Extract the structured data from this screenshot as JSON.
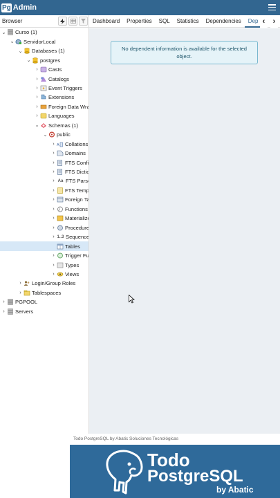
{
  "app": {
    "logo_mark": "Pg",
    "logo_text": "Admin"
  },
  "left_panel": {
    "title": "Browser"
  },
  "toolbar": {
    "icons": [
      "query-tool-icon",
      "view-data-icon",
      "filter-icon"
    ]
  },
  "tabs": [
    {
      "label": "Dashboard",
      "active": false
    },
    {
      "label": "Properties",
      "active": false
    },
    {
      "label": "SQL",
      "active": false
    },
    {
      "label": "Statistics",
      "active": false
    },
    {
      "label": "Dependencies",
      "active": false
    },
    {
      "label": "Dep",
      "active": true
    }
  ],
  "tab_nav": {
    "prev": "‹",
    "next": "›"
  },
  "tree": [
    {
      "label": "Curso (1)",
      "level": 0,
      "toggle": "open",
      "icon": "server-group-icon"
    },
    {
      "label": "ServidorLocal",
      "level": 1,
      "toggle": "open",
      "icon": "server-icon"
    },
    {
      "label": "Databases (1)",
      "level": 2,
      "toggle": "open",
      "icon": "databases-icon"
    },
    {
      "label": "postgres",
      "level": 3,
      "toggle": "open",
      "icon": "database-icon"
    },
    {
      "label": "Casts",
      "level": 4,
      "toggle": "closed",
      "icon": "casts-icon"
    },
    {
      "label": "Catalogs",
      "level": 4,
      "toggle": "closed",
      "icon": "catalogs-icon"
    },
    {
      "label": "Event Triggers",
      "level": 4,
      "toggle": "closed",
      "icon": "event-triggers-icon"
    },
    {
      "label": "Extensions",
      "level": 4,
      "toggle": "closed",
      "icon": "extensions-icon"
    },
    {
      "label": "Foreign Data Wrapp",
      "level": 4,
      "toggle": "closed",
      "icon": "foreign-data-wrapper-icon"
    },
    {
      "label": "Languages",
      "level": 4,
      "toggle": "closed",
      "icon": "languages-icon"
    },
    {
      "label": "Schemas (1)",
      "level": 4,
      "toggle": "open",
      "icon": "schemas-icon"
    },
    {
      "label": "public",
      "level": 5,
      "toggle": "open",
      "icon": "schema-icon"
    },
    {
      "label": "Collations",
      "level": 6,
      "toggle": "closed",
      "icon": "collations-icon"
    },
    {
      "label": "Domains",
      "level": 6,
      "toggle": "closed",
      "icon": "domains-icon"
    },
    {
      "label": "FTS Configu",
      "level": 6,
      "toggle": "closed",
      "icon": "fts-configurations-icon"
    },
    {
      "label": "FTS Dictiona",
      "level": 6,
      "toggle": "closed",
      "icon": "fts-dictionaries-icon"
    },
    {
      "label": "FTS Parsers",
      "level": 6,
      "toggle": "closed",
      "icon": "fts-parsers-icon",
      "icon_text": "Aa"
    },
    {
      "label": "FTS Templat",
      "level": 6,
      "toggle": "closed",
      "icon": "fts-templates-icon"
    },
    {
      "label": "Foreign Tabl",
      "level": 6,
      "toggle": "closed",
      "icon": "foreign-tables-icon"
    },
    {
      "label": "Functions",
      "level": 6,
      "toggle": "closed",
      "icon": "functions-icon"
    },
    {
      "label": "Materialized",
      "level": 6,
      "toggle": "closed",
      "icon": "materialized-views-icon"
    },
    {
      "label": "Procedures",
      "level": 6,
      "toggle": "closed",
      "icon": "procedures-icon"
    },
    {
      "label": "Sequences",
      "level": 6,
      "toggle": "closed",
      "icon": "sequences-icon",
      "icon_text": "1..3"
    },
    {
      "label": "Tables",
      "level": 6,
      "toggle": "none",
      "icon": "tables-icon",
      "selected": true
    },
    {
      "label": "Trigger Func",
      "level": 6,
      "toggle": "closed",
      "icon": "trigger-functions-icon"
    },
    {
      "label": "Types",
      "level": 6,
      "toggle": "closed",
      "icon": "types-icon"
    },
    {
      "label": "Views",
      "level": 6,
      "toggle": "closed",
      "icon": "views-icon"
    },
    {
      "label": "Login/Group Roles",
      "level": 2,
      "toggle": "closed",
      "icon": "login-roles-icon"
    },
    {
      "label": "Tablespaces",
      "level": 2,
      "toggle": "closed",
      "icon": "tablespaces-icon"
    },
    {
      "label": "PGPOOL",
      "level": 0,
      "toggle": "closed",
      "icon": "server-group-icon"
    },
    {
      "label": "Servers",
      "level": 0,
      "toggle": "closed",
      "icon": "server-group-icon"
    }
  ],
  "message": "No dependent information is available for the selected object.",
  "banner": {
    "caption": "Todo PostgreSQL by Abatic Soluciones Tecnológicas",
    "line1": "Todo",
    "line2": "PostgreSQL",
    "byline": "by Abatic"
  },
  "colors": {
    "header": "#326690",
    "selection": "#d7e8f7",
    "panel_bg": "#ebeff3",
    "alert_bg": "#e5f3f8",
    "alert_border": "#7ab8cf",
    "banner_bg": "#2f6a9a"
  }
}
